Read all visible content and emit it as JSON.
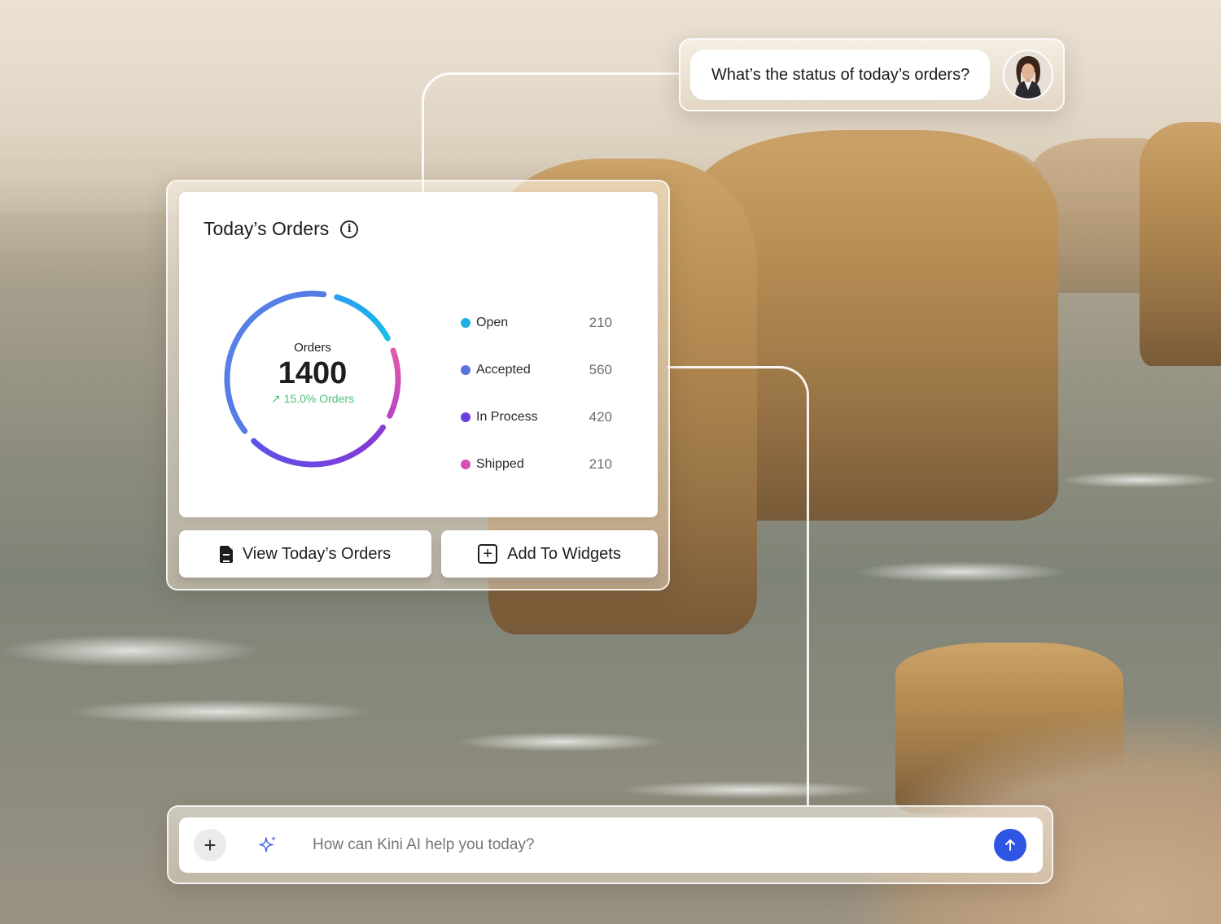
{
  "chat": {
    "question": "What’s the status of today’s orders?"
  },
  "widget": {
    "title": "Today’s Orders",
    "donut": {
      "label": "Orders",
      "total": "1400",
      "delta": "15.0% Orders"
    },
    "legend": [
      {
        "name": "Open",
        "value": "210",
        "color": "#1fb0e6"
      },
      {
        "name": "Accepted",
        "value": "560",
        "color": "#5473e0"
      },
      {
        "name": "In Process",
        "value": "420",
        "color": "#6a3fe0"
      },
      {
        "name": "Shipped",
        "value": "210",
        "color": "#d94fb0"
      }
    ],
    "buttons": {
      "view": "View Today’s Orders",
      "add": "Add To Widgets"
    }
  },
  "input": {
    "placeholder": "How can Kini AI help you today?"
  },
  "colors": {
    "accent": "#2f55e4",
    "positive": "#4cc27a"
  }
}
